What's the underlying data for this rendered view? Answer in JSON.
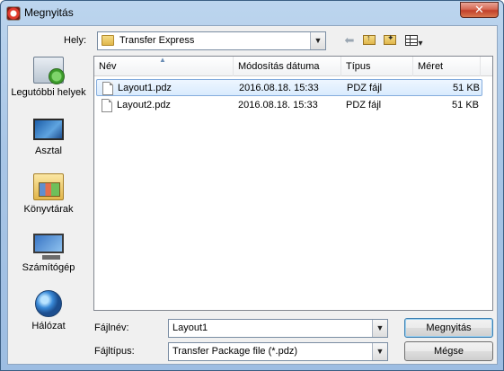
{
  "window": {
    "title": "Megnyitás",
    "close_glyph": "✕"
  },
  "lookin": {
    "label": "Hely:",
    "value": "Transfer Express",
    "dropdown_glyph": "▼"
  },
  "toolbar": {
    "back_glyph": "⬅",
    "view_glyph": "▾"
  },
  "places": [
    {
      "label": "Legutóbbi helyek",
      "icon": "recent-places-icon"
    },
    {
      "label": "Asztal",
      "icon": "desktop-icon"
    },
    {
      "label": "Könyvtárak",
      "icon": "libraries-icon"
    },
    {
      "label": "Számítógép",
      "icon": "computer-icon"
    },
    {
      "label": "Hálózat",
      "icon": "network-icon"
    }
  ],
  "columns": {
    "name": "Név",
    "date": "Módosítás dátuma",
    "type": "Típus",
    "size": "Méret"
  },
  "files": [
    {
      "name": "Layout1.pdz",
      "date": "2016.08.18. 15:33",
      "type": "PDZ fájl",
      "size": "51 KB",
      "selected": true
    },
    {
      "name": "Layout2.pdz",
      "date": "2016.08.18. 15:33",
      "type": "PDZ fájl",
      "size": "51 KB",
      "selected": false
    }
  ],
  "filename": {
    "label": "Fájlnév:",
    "value": "Layout1"
  },
  "filetype": {
    "label": "Fájltípus:",
    "value": "Transfer Package file (*.pdz)"
  },
  "buttons": {
    "open": "Megnyitás",
    "cancel": "Mégse"
  },
  "colors": {
    "selection": "#d9ebfd",
    "selection_border": "#84acdd",
    "close": "#c2412a"
  }
}
